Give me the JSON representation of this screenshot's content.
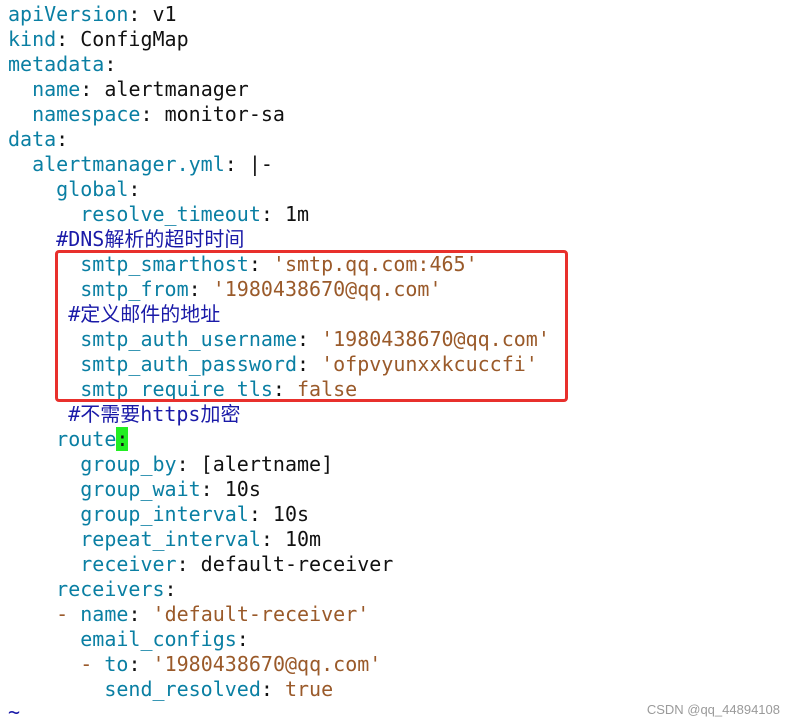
{
  "colors": {
    "key": "#0a7fa3",
    "string": "#9a5a2a",
    "comment": "#1a1aa8",
    "highlight_box": "#e8302c",
    "cursor": "#22ee22"
  },
  "lines": [
    [
      {
        "t": "apiVersion",
        "c": "key"
      },
      {
        "t": ": ",
        "c": "plain"
      },
      {
        "t": "v1",
        "c": "plain"
      }
    ],
    [
      {
        "t": "kind",
        "c": "key"
      },
      {
        "t": ": ",
        "c": "plain"
      },
      {
        "t": "ConfigMap",
        "c": "plain"
      }
    ],
    [
      {
        "t": "metadata",
        "c": "key"
      },
      {
        "t": ":",
        "c": "plain"
      }
    ],
    [
      {
        "t": "  ",
        "c": "ind"
      },
      {
        "t": "name",
        "c": "key"
      },
      {
        "t": ": ",
        "c": "plain"
      },
      {
        "t": "alertmanager",
        "c": "plain"
      }
    ],
    [
      {
        "t": "  ",
        "c": "ind"
      },
      {
        "t": "namespace",
        "c": "key"
      },
      {
        "t": ": ",
        "c": "plain"
      },
      {
        "t": "monitor-sa",
        "c": "plain"
      }
    ],
    [
      {
        "t": "data",
        "c": "key"
      },
      {
        "t": ":",
        "c": "plain"
      }
    ],
    [
      {
        "t": "  ",
        "c": "ind"
      },
      {
        "t": "alertmanager.yml",
        "c": "key"
      },
      {
        "t": ": ",
        "c": "plain"
      },
      {
        "t": "|-",
        "c": "plain"
      }
    ],
    [
      {
        "t": "    ",
        "c": "ind"
      },
      {
        "t": "global",
        "c": "key"
      },
      {
        "t": ":",
        "c": "plain"
      }
    ],
    [
      {
        "t": "      ",
        "c": "ind"
      },
      {
        "t": "resolve_timeout",
        "c": "key"
      },
      {
        "t": ": ",
        "c": "plain"
      },
      {
        "t": "1m",
        "c": "plain"
      }
    ],
    [
      {
        "t": "    ",
        "c": "ind"
      },
      {
        "t": "#DNS解析的超时时间",
        "c": "comment"
      }
    ],
    [
      {
        "t": "      ",
        "c": "ind"
      },
      {
        "t": "smtp_smarthost",
        "c": "key"
      },
      {
        "t": ": ",
        "c": "plain"
      },
      {
        "t": "'smtp.qq.com:465'",
        "c": "str"
      }
    ],
    [
      {
        "t": "      ",
        "c": "ind"
      },
      {
        "t": "smtp_from",
        "c": "key"
      },
      {
        "t": ": ",
        "c": "plain"
      },
      {
        "t": "'1980438670@qq.com'",
        "c": "str"
      }
    ],
    [
      {
        "t": "     ",
        "c": "ind"
      },
      {
        "t": "#定义邮件的地址",
        "c": "comment"
      }
    ],
    [
      {
        "t": "      ",
        "c": "ind"
      },
      {
        "t": "smtp_auth_username",
        "c": "key"
      },
      {
        "t": ": ",
        "c": "plain"
      },
      {
        "t": "'1980438670@qq.com'",
        "c": "str"
      }
    ],
    [
      {
        "t": "      ",
        "c": "ind"
      },
      {
        "t": "smtp_auth_password",
        "c": "key"
      },
      {
        "t": ": ",
        "c": "plain"
      },
      {
        "t": "'ofpvyunxxkcuccfi'",
        "c": "str"
      }
    ],
    [
      {
        "t": "      ",
        "c": "ind"
      },
      {
        "t": "smtp_require_tls",
        "c": "key"
      },
      {
        "t": ": ",
        "c": "plain"
      },
      {
        "t": "false",
        "c": "bool"
      }
    ],
    [
      {
        "t": "     ",
        "c": "ind"
      },
      {
        "t": "#不需要https加密",
        "c": "comment"
      }
    ],
    [
      {
        "t": "    ",
        "c": "ind"
      },
      {
        "t": "route",
        "c": "key"
      },
      {
        "t": ":",
        "c": "cursor"
      }
    ],
    [
      {
        "t": "      ",
        "c": "ind"
      },
      {
        "t": "group_by",
        "c": "key"
      },
      {
        "t": ": ",
        "c": "plain"
      },
      {
        "t": "[alertname]",
        "c": "plain"
      }
    ],
    [
      {
        "t": "      ",
        "c": "ind"
      },
      {
        "t": "group_wait",
        "c": "key"
      },
      {
        "t": ": ",
        "c": "plain"
      },
      {
        "t": "10s",
        "c": "plain"
      }
    ],
    [
      {
        "t": "      ",
        "c": "ind"
      },
      {
        "t": "group_interval",
        "c": "key"
      },
      {
        "t": ": ",
        "c": "plain"
      },
      {
        "t": "10s",
        "c": "plain"
      }
    ],
    [
      {
        "t": "      ",
        "c": "ind"
      },
      {
        "t": "repeat_interval",
        "c": "key"
      },
      {
        "t": ": ",
        "c": "plain"
      },
      {
        "t": "10m",
        "c": "plain"
      }
    ],
    [
      {
        "t": "      ",
        "c": "ind"
      },
      {
        "t": "receiver",
        "c": "key"
      },
      {
        "t": ": ",
        "c": "plain"
      },
      {
        "t": "default-receiver",
        "c": "plain"
      }
    ],
    [
      {
        "t": "    ",
        "c": "ind"
      },
      {
        "t": "receivers",
        "c": "key"
      },
      {
        "t": ":",
        "c": "plain"
      }
    ],
    [
      {
        "t": "    ",
        "c": "ind"
      },
      {
        "t": "- ",
        "c": "str"
      },
      {
        "t": "name",
        "c": "key"
      },
      {
        "t": ": ",
        "c": "plain"
      },
      {
        "t": "'default-receiver'",
        "c": "str"
      }
    ],
    [
      {
        "t": "      ",
        "c": "ind"
      },
      {
        "t": "email_configs",
        "c": "key"
      },
      {
        "t": ":",
        "c": "plain"
      }
    ],
    [
      {
        "t": "      ",
        "c": "ind"
      },
      {
        "t": "- ",
        "c": "str"
      },
      {
        "t": "to",
        "c": "key"
      },
      {
        "t": ": ",
        "c": "plain"
      },
      {
        "t": "'1980438670@qq.com'",
        "c": "str"
      }
    ],
    [
      {
        "t": "        ",
        "c": "ind"
      },
      {
        "t": "send_resolved",
        "c": "key"
      },
      {
        "t": ": ",
        "c": "plain"
      },
      {
        "t": "true",
        "c": "bool"
      }
    ]
  ],
  "tilde": "~",
  "watermark": "CSDN @qq_44894108"
}
